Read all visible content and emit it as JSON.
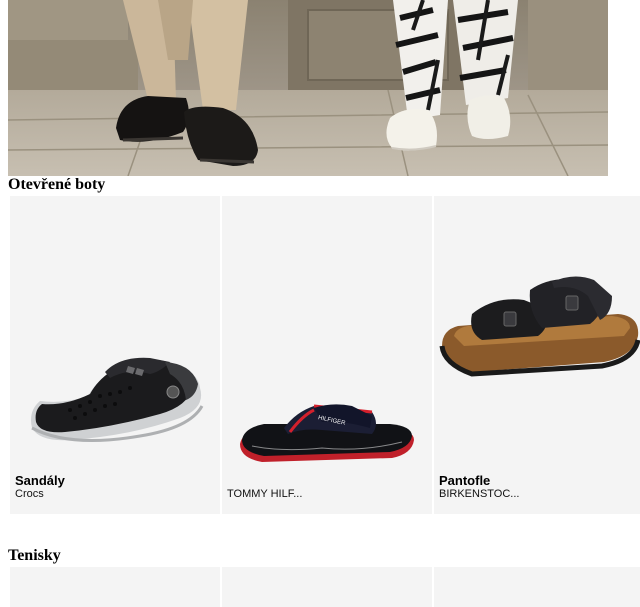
{
  "sections": [
    {
      "title": "Otevřené boty",
      "cards": [
        {
          "title": "Sandály",
          "brand": "Crocs",
          "image_icon": "crocs-clog-icon"
        },
        {
          "title": "",
          "brand": "TOMMY HILF...",
          "image_icon": "flip-flop-icon"
        },
        {
          "title": "Pantofle",
          "brand": "BIRKENSTOC...",
          "image_icon": "birkenstock-slide-icon"
        }
      ]
    },
    {
      "title": "Tenisky",
      "cards": []
    }
  ],
  "hero": {
    "image_icon": "lifestyle-photo-shoes"
  },
  "colors": {
    "card_bg": "#f4f4f4",
    "page_bg": "#ffffff"
  }
}
